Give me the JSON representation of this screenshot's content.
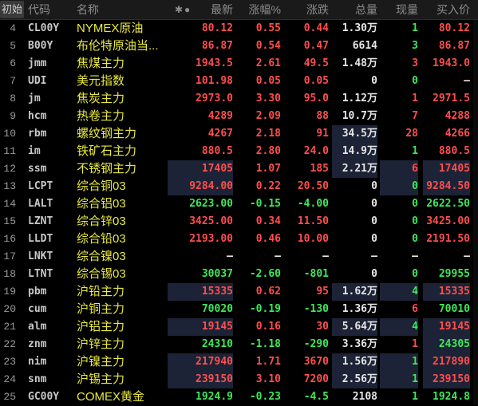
{
  "header": {
    "init_tab": "初始",
    "col_code": "代码",
    "col_name": "名称",
    "settings_glyph": "✱●",
    "col_last": "最新",
    "col_pct": "涨幅%",
    "col_chg": "涨跌",
    "col_vol": "总量",
    "col_cur": "现量",
    "col_bid": "买入价"
  },
  "colors": {
    "up": "#ff4e4e",
    "down": "#3ee85a",
    "name": "#e8e840",
    "highlight": "#1d2336"
  },
  "rows": [
    {
      "idx": "4",
      "code": "CL00Y",
      "name": "NYMEX原油",
      "last": "80.12",
      "pct": "0.55",
      "chg": "0.44",
      "vol": "1.30万",
      "cur": "1",
      "bid": "80.12",
      "dir": "up",
      "cur_dir": "down",
      "hl": []
    },
    {
      "idx": "5",
      "code": "B00Y",
      "name": "布伦特原油当...",
      "last": "86.87",
      "pct": "0.54",
      "chg": "0.47",
      "vol": "6614",
      "cur": "3",
      "bid": "86.87",
      "dir": "up",
      "cur_dir": "down",
      "hl": []
    },
    {
      "idx": "6",
      "code": "jmm",
      "name": "焦煤主力",
      "last": "1943.5",
      "pct": "2.61",
      "chg": "49.5",
      "vol": "1.48万",
      "cur": "3",
      "bid": "1943.0",
      "dir": "up",
      "cur_dir": "up",
      "hl": []
    },
    {
      "idx": "7",
      "code": "UDI",
      "name": "美元指数",
      "last": "101.98",
      "pct": "0.05",
      "chg": "0.05",
      "vol": "0",
      "cur": "0",
      "bid": "—",
      "dir": "up",
      "cur_dir": "down",
      "hl": []
    },
    {
      "idx": "8",
      "code": "jm",
      "name": "焦炭主力",
      "last": "2973.0",
      "pct": "3.30",
      "chg": "95.0",
      "vol": "1.12万",
      "cur": "1",
      "bid": "2971.5",
      "dir": "up",
      "cur_dir": "up",
      "hl": []
    },
    {
      "idx": "9",
      "code": "hcm",
      "name": "热卷主力",
      "last": "4289",
      "pct": "2.09",
      "chg": "88",
      "vol": "10.7万",
      "cur": "7",
      "bid": "4288",
      "dir": "up",
      "cur_dir": "up",
      "hl": []
    },
    {
      "idx": "10",
      "code": "rbm",
      "name": "螺纹钢主力",
      "last": "4267",
      "pct": "2.18",
      "chg": "91",
      "vol": "34.5万",
      "cur": "28",
      "bid": "4266",
      "dir": "up",
      "cur_dir": "up",
      "hl": [
        "vol"
      ]
    },
    {
      "idx": "11",
      "code": "im",
      "name": "铁矿石主力",
      "last": "880.5",
      "pct": "2.80",
      "chg": "24.0",
      "vol": "14.9万",
      "cur": "1",
      "bid": "880.5",
      "dir": "up",
      "cur_dir": "down",
      "hl": [
        "vol"
      ]
    },
    {
      "idx": "12",
      "code": "ssm",
      "name": "不锈钢主力",
      "last": "17405",
      "pct": "1.07",
      "chg": "185",
      "vol": "2.21万",
      "cur": "6",
      "bid": "17405",
      "dir": "up",
      "cur_dir": "up",
      "hl": [
        "last",
        "vol",
        "cur",
        "bid"
      ]
    },
    {
      "idx": "13",
      "code": "LCPT",
      "name": "综合铜03",
      "last": "9284.00",
      "pct": "0.22",
      "chg": "20.50",
      "vol": "0",
      "cur": "0",
      "bid": "9284.50",
      "dir": "up",
      "cur_dir": "down",
      "hl": [
        "last",
        "cur",
        "bid"
      ]
    },
    {
      "idx": "14",
      "code": "LALT",
      "name": "综合铝03",
      "last": "2623.00",
      "pct": "-0.15",
      "chg": "-4.00",
      "vol": "0",
      "cur": "0",
      "bid": "2622.50",
      "dir": "down",
      "cur_dir": "down",
      "hl": []
    },
    {
      "idx": "15",
      "code": "LZNT",
      "name": "综合锌03",
      "last": "3425.00",
      "pct": "0.34",
      "chg": "11.50",
      "vol": "0",
      "cur": "0",
      "bid": "3425.00",
      "dir": "up",
      "cur_dir": "down",
      "hl": []
    },
    {
      "idx": "16",
      "code": "LLDT",
      "name": "综合铅03",
      "last": "2193.00",
      "pct": "0.46",
      "chg": "10.00",
      "vol": "0",
      "cur": "0",
      "bid": "2191.50",
      "dir": "up",
      "cur_dir": "down",
      "hl": []
    },
    {
      "idx": "17",
      "code": "LNKT",
      "name": "综合镍03",
      "last": "—",
      "pct": "—",
      "chg": "—",
      "vol": "—",
      "cur": "—",
      "bid": "—",
      "dir": "none",
      "cur_dir": "none",
      "hl": []
    },
    {
      "idx": "18",
      "code": "LTNT",
      "name": "综合锡03",
      "last": "30037",
      "pct": "-2.60",
      "chg": "-801",
      "vol": "0",
      "cur": "0",
      "bid": "29955",
      "dir": "down",
      "cur_dir": "down",
      "hl": []
    },
    {
      "idx": "19",
      "code": "pbm",
      "name": "沪铅主力",
      "last": "15335",
      "pct": "0.62",
      "chg": "95",
      "vol": "1.62万",
      "cur": "4",
      "bid": "15335",
      "dir": "up",
      "cur_dir": "down",
      "hl": [
        "last",
        "vol",
        "cur",
        "bid"
      ]
    },
    {
      "idx": "20",
      "code": "cum",
      "name": "沪铜主力",
      "last": "70020",
      "pct": "-0.19",
      "chg": "-130",
      "vol": "1.36万",
      "cur": "6",
      "bid": "70010",
      "dir": "down",
      "cur_dir": "up",
      "hl": []
    },
    {
      "idx": "21",
      "code": "alm",
      "name": "沪铝主力",
      "last": "19145",
      "pct": "0.16",
      "chg": "30",
      "vol": "5.64万",
      "cur": "4",
      "bid": "19145",
      "dir": "up",
      "cur_dir": "down",
      "hl": [
        "last",
        "vol",
        "cur",
        "bid"
      ]
    },
    {
      "idx": "22",
      "code": "znm",
      "name": "沪锌主力",
      "last": "24310",
      "pct": "-1.18",
      "chg": "-290",
      "vol": "3.36万",
      "cur": "1",
      "bid": "24305",
      "dir": "down",
      "cur_dir": "up",
      "hl": [
        "bid"
      ]
    },
    {
      "idx": "23",
      "code": "nim",
      "name": "沪镍主力",
      "last": "217940",
      "pct": "1.71",
      "chg": "3670",
      "vol": "1.56万",
      "cur": "1",
      "bid": "217890",
      "dir": "up",
      "cur_dir": "down",
      "hl": [
        "last",
        "vol",
        "cur",
        "bid"
      ]
    },
    {
      "idx": "24",
      "code": "snm",
      "name": "沪锡主力",
      "last": "239150",
      "pct": "3.10",
      "chg": "7200",
      "vol": "2.56万",
      "cur": "1",
      "bid": "239150",
      "dir": "up",
      "cur_dir": "down",
      "hl": [
        "last",
        "vol",
        "cur",
        "bid"
      ]
    },
    {
      "idx": "25",
      "code": "GC00Y",
      "name": "COMEX黄金",
      "last": "1924.9",
      "pct": "-0.23",
      "chg": "-4.5",
      "vol": "2108",
      "cur": "1",
      "bid": "1924.8",
      "dir": "down",
      "cur_dir": "down",
      "hl": []
    }
  ]
}
